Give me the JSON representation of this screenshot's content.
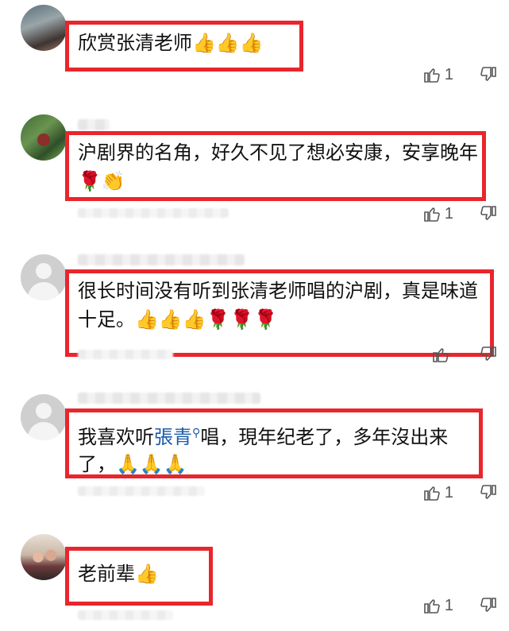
{
  "comments": [
    {
      "text": "欣赏张清老师",
      "emojis": [
        "👍",
        "👍",
        "👍"
      ],
      "likes": "1"
    },
    {
      "text": "沪剧界的名角，好久不见了想必安康，安享晚年",
      "emojis": [
        "🌹",
        "👏"
      ],
      "likes": "1"
    },
    {
      "text": "很长时间没有听到张清老师唱的沪剧，真是味道十足。",
      "emojis": [
        "👍",
        "👍",
        "👍",
        "🌹",
        "🌹",
        "🌹"
      ],
      "likes": ""
    },
    {
      "text_before": "我喜欢听",
      "link": "張青",
      "search_glyph": "🔍",
      "text_after": "唱，現年纪老了，多年沒出来了，",
      "emojis": [
        "🙏",
        "🙏",
        "🙏"
      ],
      "likes": "1"
    },
    {
      "text": "老前辈",
      "emojis": [
        "👍"
      ],
      "likes": "1"
    }
  ],
  "colors": {
    "highlight": "#e8262c",
    "link": "#1a5aa8"
  }
}
